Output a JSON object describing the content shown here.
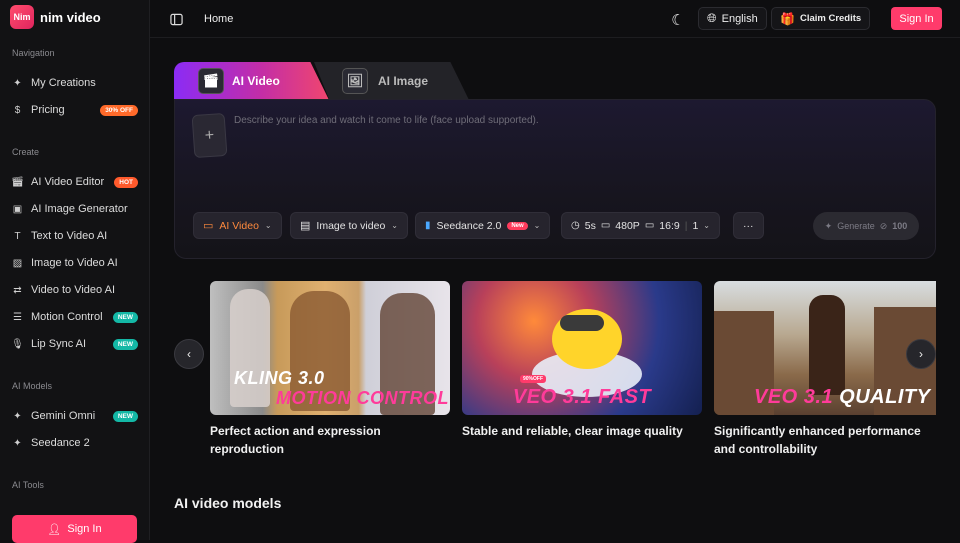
{
  "app": {
    "logo_mark": "Nim",
    "name": "nim video"
  },
  "sidebar": {
    "navigation_label": "Navigation",
    "navigation": [
      {
        "label": "My Creations",
        "icon": "sparkles-icon"
      },
      {
        "label": "Pricing",
        "icon": "dollar-icon",
        "badge": "30% OFF"
      }
    ],
    "create_label": "Create",
    "create": [
      {
        "label": "AI Video Editor",
        "icon": "clapperboard-icon",
        "badge": "HOT"
      },
      {
        "label": "AI Image Generator",
        "icon": "image-sparkle-icon"
      },
      {
        "label": "Text to Video AI",
        "icon": "text-icon"
      },
      {
        "label": "Image to Video AI",
        "icon": "image-icon"
      },
      {
        "label": "Video to Video AI",
        "icon": "swap-icon"
      },
      {
        "label": "Motion Control",
        "icon": "sliders-icon",
        "badge": "NEW"
      },
      {
        "label": "Lip Sync AI",
        "icon": "mic-icon",
        "badge": "NEW"
      }
    ],
    "models_label": "AI Models",
    "models": [
      {
        "label": "Gemini Omni",
        "icon": "sparkles-icon",
        "badge": "NEW"
      },
      {
        "label": "Seedance 2",
        "icon": "sparkles-icon"
      }
    ],
    "tools_label": "AI Tools",
    "signin_label": "Sign In"
  },
  "topbar": {
    "breadcrumb": "Home",
    "language": "English",
    "claim_credits": "Claim Credits",
    "signin": "Sign In"
  },
  "tabs": [
    {
      "label": "AI Video",
      "active": true
    },
    {
      "label": "AI Image",
      "active": false
    }
  ],
  "prompt": {
    "placeholder": "Describe your idea and watch it come to life (face upload supported).",
    "options": {
      "mode": "AI Video",
      "type": "Image to video",
      "model": "Seedance 2.0",
      "model_badge": "New",
      "duration": "5s",
      "resolution": "480P",
      "ratio": "16:9",
      "count": "1",
      "more": "···"
    },
    "generate_label": "Generate",
    "generate_cost": "100"
  },
  "carousel": [
    {
      "title": "KLING 3.0",
      "subtitle": "MOTION CONTROL",
      "description": "Perfect action and expression reproduction"
    },
    {
      "title": "VEO 3.1 FAST",
      "subtitle": "",
      "tag": "90%OFF",
      "description": "Stable and reliable, clear image quality"
    },
    {
      "title": "VEO 3.1",
      "subtitle": "QUALITY",
      "description": "Significantly enhanced performance and controllability"
    }
  ],
  "section_title": "AI video models",
  "colors": {
    "accent": "#ff3b6b",
    "new_badge": "#14b8a6",
    "hot_badge": "#ff5a2c"
  }
}
